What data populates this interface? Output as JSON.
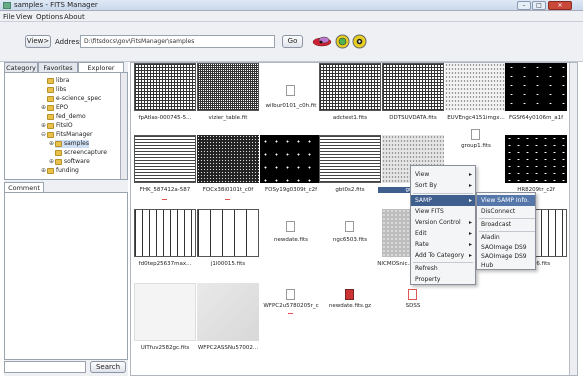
{
  "window": {
    "title": "samples - FITS Manager"
  },
  "menu": [
    "File",
    "View",
    "Options",
    "About"
  ],
  "toolbar": {
    "view_label": "View>",
    "address_label": "Address",
    "address_value": "D:\\fitsdocs\\gov\\FitsManager\\samples",
    "go_label": "Go"
  },
  "left_tabs": [
    "Category",
    "Favorites",
    "Explorer"
  ],
  "tree": [
    "libra",
    "libs",
    "e-science_spec",
    "EPO",
    "fed_demo",
    "FitsIO",
    "FitsManager",
    "samples",
    "screencapture",
    "software",
    "funding"
  ],
  "comment_tab": "Comment",
  "search_label": "Search",
  "files": [
    "fpAtlas-000745-5...",
    "vizier_table.fit",
    "wilbur0101_c0h.fit",
    "adctest1.fits",
    "DDTSUVDATA.fits",
    "EUVEngc4151imgx...",
    "FGSf64y0106m_a1f",
    "FHK_587412a-587",
    "FOCx38i0101t_c0f",
    "FOSy19g0309t_c2f",
    "gbt0s2.fits",
    "grO...",
    "group1.fits",
    "HR8209tr_c2f",
    "fd0tep25637max...",
    "j1l00015.fits",
    "newdate.fits",
    "ngc6503.fits",
    "NICMOSnic...",
    "",
    "tf1426.fits",
    "UITfuv2582gc.fits",
    "WFPC2ASSNu57002...",
    "WFPC2u5780205r_c",
    "newdate.fits.gz",
    "SDSS"
  ],
  "context_menu": {
    "items": [
      "View",
      "Sort By",
      "SAMP",
      "View FITS",
      "Version Control",
      "Edit",
      "Rate",
      "Add To Category",
      "Refresh",
      "Property"
    ],
    "selected": "SAMP"
  },
  "submenu": {
    "items": [
      "View SAMP Info.",
      "DisConnect",
      "Broadcast",
      "Aladin",
      "SAOImage DS9",
      "SAOImage DS9",
      "Hub"
    ],
    "selected": "View SAMP Info."
  },
  "colors": {
    "menu_highlight": "#3f5f8f",
    "folder": "#e8c04a"
  }
}
